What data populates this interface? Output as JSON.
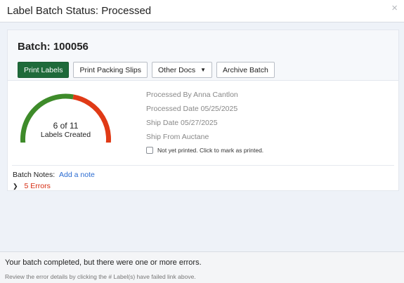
{
  "modal": {
    "title": "Label Batch Status: Processed",
    "close_symbol": "×"
  },
  "batch": {
    "title": "Batch: 100056",
    "buttons": {
      "print_labels": "Print Labels",
      "print_packing_slips": "Print Packing Slips",
      "other_docs": "Other Docs",
      "archive_batch": "Archive Batch"
    }
  },
  "gauge": {
    "created": 6,
    "total": 11,
    "count_text": "6 of 11",
    "caption": "Labels Created",
    "colors": {
      "done": "#3e8b2a",
      "remaining": "#e03a16"
    }
  },
  "info": {
    "processed_by": "Processed By Anna Cantlon",
    "processed_date": "Processed Date 05/25/2025",
    "ship_date": "Ship Date 05/27/2025",
    "ship_from": "Ship From Auctane"
  },
  "print_status": {
    "label": "Not yet printed. Click to mark as printed."
  },
  "notes": {
    "label": "Batch Notes:",
    "add_link": "Add a note"
  },
  "errors": {
    "label": "5 Errors"
  },
  "footer": {
    "message": "Your batch completed, but there were one or more errors.",
    "hint": "Review the error details by clicking the # Label(s) have failed link above."
  },
  "colors": {
    "primary_button": "#1f6a3a",
    "link": "#2a6bd1",
    "error": "#d62a0f"
  }
}
